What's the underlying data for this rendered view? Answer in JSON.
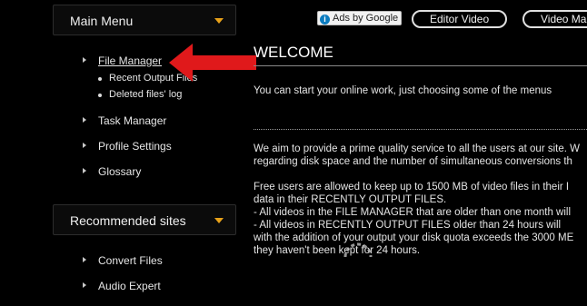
{
  "sidebar": {
    "main_menu": {
      "title": "Main Menu",
      "items": [
        {
          "label": "File Manager",
          "sub": [
            "Recent Output Files",
            "Deleted files' log"
          ]
        },
        {
          "label": "Task Manager"
        },
        {
          "label": "Profile Settings"
        },
        {
          "label": "Glossary"
        }
      ]
    },
    "recommended": {
      "title": "Recommended sites",
      "items": [
        {
          "label": "Convert Files"
        },
        {
          "label": "Audio Expert"
        }
      ]
    }
  },
  "topbar": {
    "ads_label": "Ads by Google",
    "buttons": [
      "Editor Video",
      "Video Ma"
    ]
  },
  "main": {
    "title": "WELCOME",
    "intro": "You can start your online work, just choosing some of the menus",
    "lines": [
      "We aim to provide a prime quality service to all the users at our site. W",
      "regarding disk space and the number of simultaneous conversions th",
      "Free users are allowed to keep up to 1500 MB of video files in their I",
      "data in their RECENTLY OUTPUT FILES.",
      "- All videos in the FILE MANAGER that are older than one month will",
      "- All videos in RECENTLY OUTPUT FILES older than 24 hours will",
      "with the addition of your output your disk quota exceeds the 3000 ME",
      "they haven't been kept for 24 hours."
    ]
  },
  "colors": {
    "accent": "#e8a21a",
    "arrow": "#e0191b",
    "background": "#000000"
  }
}
